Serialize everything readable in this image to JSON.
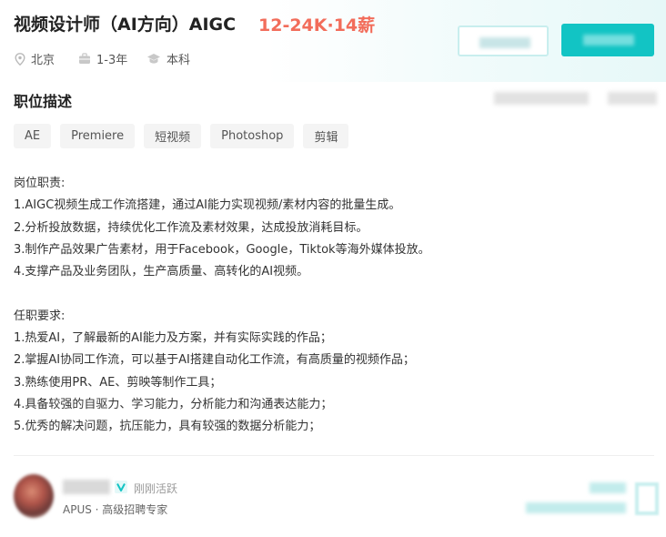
{
  "header": {
    "title": "视频设计师（AI方向）AIGC",
    "salary": "12-24K·14薪",
    "meta": [
      {
        "icon": "location-icon",
        "text": "北京"
      },
      {
        "icon": "briefcase-icon",
        "text": "1-3年"
      },
      {
        "icon": "graduation-cap-icon",
        "text": "本科"
      }
    ]
  },
  "section": {
    "title": "职位描述"
  },
  "tags": [
    "AE",
    "Premiere",
    "短视频",
    "Photoshop",
    "剪辑"
  ],
  "description": {
    "duties_title": "岗位职责:",
    "duties": [
      "1.AIGC视频生成工作流搭建，通过AI能力实现视频/素材内容的批量生成。",
      "2.分析投放数据，持续优化工作流及素材效果，达成投放消耗目标。",
      "3.制作产品效果广告素材，用于Facebook，Google，Tiktok等海外媒体投放。",
      "4.支撑产品及业务团队，生产高质量、高转化的AI视频。"
    ],
    "requirements_title": "任职要求:",
    "requirements": [
      "1.热爱AI，了解最新的AI能力及方案，并有实际实践的作品；",
      "2.掌握AI协同工作流，可以基于AI搭建自动化工作流，有高质量的视频作品；",
      "3.熟练使用PR、AE、剪映等制作工具；",
      "4.具备较强的自驱力、学习能力，分析能力和沟通表达能力；",
      "5.优秀的解决问题，抗压能力，具有较强的数据分析能力；"
    ]
  },
  "recruiter": {
    "status": "刚刚活跃",
    "company_line": "APUS · 高级招聘专家"
  },
  "colors": {
    "accent": "#12c4c4",
    "salary": "#f26d5b"
  }
}
